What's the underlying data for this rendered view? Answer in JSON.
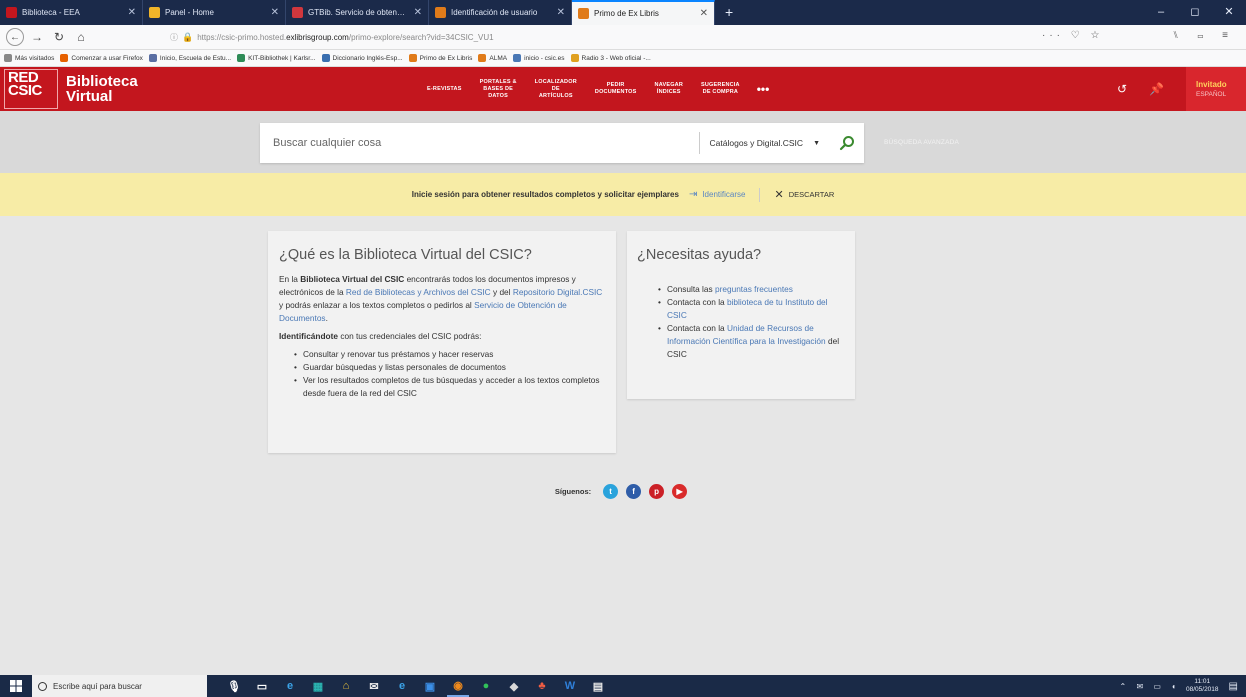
{
  "browser": {
    "tabs": [
      {
        "label": "Biblioteca - EEA",
        "favicon_color": "#c3161e",
        "active": false
      },
      {
        "label": "Panel - Home",
        "favicon_color": "#f0b429",
        "active": false
      },
      {
        "label": "GTBib. Servicio de obtencion d",
        "favicon_color": "#d1373d",
        "active": false
      },
      {
        "label": "Identificación de usuario",
        "favicon_color": "#e07b1a",
        "active": false
      },
      {
        "label": "Primo de Ex Libris",
        "favicon_color": "#e07b1a",
        "active": true
      }
    ],
    "new_tab": "+",
    "window_controls": {
      "minimize": "–",
      "maximize": "◻",
      "close": "✕"
    },
    "url_prefix": "https://csic-primo.hosted.",
    "url_domain": "exlibrisgroup.com",
    "url_suffix": "/primo-explore/search?vid=34CSIC_VU1",
    "url_tools": "··· ♡ ☆",
    "right_tools": "⑊ ▭ ≡",
    "bookmarks": [
      {
        "label": "Más visitados",
        "color": "#888"
      },
      {
        "label": "Comenzar a usar Firefox",
        "color": "#e66000"
      },
      {
        "label": "Inicio, Escuela de Estu...",
        "color": "#5a6ea3"
      },
      {
        "label": "KIT-Bibliothek | Karlsr...",
        "color": "#2e8b57"
      },
      {
        "label": "Diccionario Inglés-Esp...",
        "color": "#3a6fb0"
      },
      {
        "label": "Primo de Ex Libris",
        "color": "#e07b1a"
      },
      {
        "label": "ALMA",
        "color": "#e07b1a"
      },
      {
        "label": "inicio - csic.es",
        "color": "#4a78b5"
      },
      {
        "label": "Radio 3 - Web oficial -...",
        "color": "#e0a020"
      }
    ]
  },
  "primo": {
    "logo": {
      "mark": "RED",
      "mark2": "CSIC",
      "line1": "Biblioteca",
      "line2": "Virtual"
    },
    "nav": [
      {
        "line1": "E-REVISTAS",
        "line2": "",
        "line3": ""
      },
      {
        "line1": "PORTALES &",
        "line2": "BASES DE",
        "line3": "DATOS"
      },
      {
        "line1": "LOCALIZADOR",
        "line2": "DE",
        "line3": "ARTÍCULOS"
      },
      {
        "line1": "PEDIR",
        "line2": "DOCUMENTOS",
        "line3": ""
      },
      {
        "line1": "NAVEGAR",
        "line2": "ÍNDICES",
        "line3": ""
      },
      {
        "line1": "SUGERENCIA",
        "line2": "DE COMPRA",
        "line3": ""
      }
    ],
    "more": "•••",
    "user": {
      "name": "Invitado",
      "language": "ESPAÑOL"
    },
    "accent": "#c3161e"
  },
  "search": {
    "placeholder": "Buscar cualquier cosa",
    "scope": "Catálogos y Digital.CSIC",
    "advanced": "BÚSQUEDA AVANZADA"
  },
  "banner": {
    "message": "Inicie sesión para obtener resultados completos y solicitar ejemplares",
    "signin": "Identificarse",
    "dismiss": "DESCARTAR"
  },
  "card_about": {
    "title": "¿Qué es la Biblioteca Virtual del CSIC?",
    "p1_pre": "En la ",
    "p1_bold": "Biblioteca Virtual del CSIC",
    "p1_a": " encontrarás todos los documentos impresos y electrónicos de la ",
    "p1_link1": "Red de Bibliotecas y Archivos del CSIC",
    "p1_b": " y del ",
    "p1_link2": "Repositorio Digital.CSIC",
    "p1_c": " y podrás enlazar a los textos completos o pedirlos al ",
    "p1_link3": "Servicio de Obtención de Documentos",
    "p1_d": ".",
    "p2_bold": "Identificándote",
    "p2_rest": " con tus credenciales del CSIC podrás:",
    "items": [
      "Consultar y renovar tus préstamos y hacer reservas",
      "Guardar búsquedas y listas personales de documentos",
      "Ver los resultados completos de tus búsquedas y acceder a los textos completos desde fuera de la red del CSIC"
    ]
  },
  "card_help": {
    "title": "¿Necesitas ayuda?",
    "i1_pre": "Consulta las ",
    "i1_link": "preguntas frecuentes",
    "i2_pre": "Contacta con la ",
    "i2_link": "biblioteca de tu Instituto del CSIC",
    "i3_pre": "Contacta con la ",
    "i3_link": "Unidad de Recursos de Información Científica para la Investigación",
    "i3_post": " del CSIC"
  },
  "social": {
    "label": "Síguenos:",
    "networks": [
      {
        "name": "twitter-icon",
        "color": "#2aa3dc",
        "glyph": "t"
      },
      {
        "name": "facebook-icon",
        "color": "#2f5da8",
        "glyph": "f"
      },
      {
        "name": "pinterest-icon",
        "color": "#cb2027",
        "glyph": "p"
      },
      {
        "name": "youtube-icon",
        "color": "#d92b2b",
        "glyph": "▶"
      }
    ]
  },
  "taskbar": {
    "search_placeholder": "Escribe aquí para buscar",
    "time": "11:01",
    "date": "08/05/2018"
  }
}
